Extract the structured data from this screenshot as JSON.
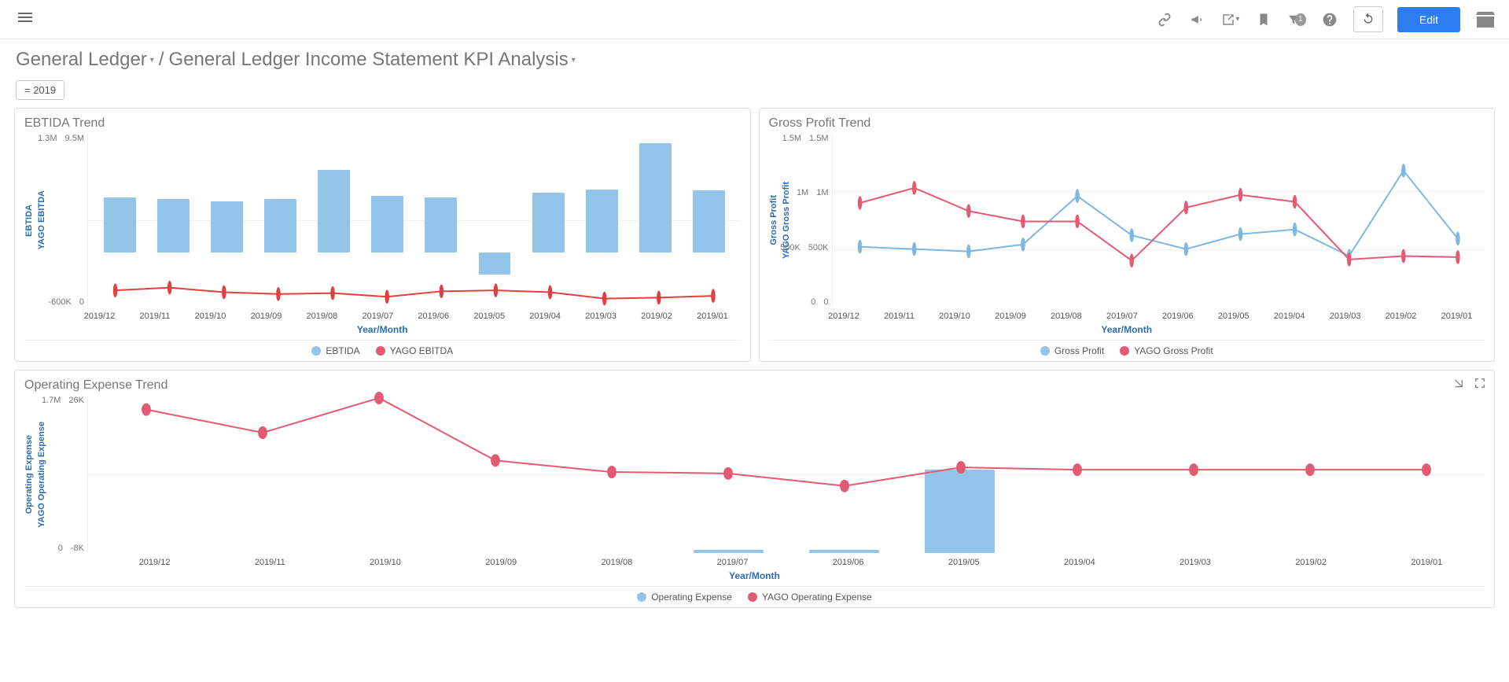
{
  "toolbar": {
    "filter_badge": "1",
    "edit_label": "Edit"
  },
  "breadcrumb": {
    "root": "General Ledger",
    "separator": "/",
    "page": "General Ledger Income Statement KPI Analysis"
  },
  "filter_chip": "= 2019",
  "panels": {
    "ebtida": {
      "title": "EBTIDA Trend",
      "y_left_top": "1.3M",
      "y_left_bot": "-600K",
      "y_right_top": "9.5M",
      "y_right_bot": "0",
      "axis1": "EBTIDA",
      "axis2": "YAGO EBITDA",
      "xlabel": "Year/Month",
      "legend1": "EBTIDA",
      "legend2": "YAGO EBITDA"
    },
    "gross": {
      "title": "Gross Profit Trend",
      "y_left_top": "1.5M",
      "y_left_mid": "1M",
      "y_left_low": "500K",
      "y_left_bot": "0",
      "y_right_top": "1.5M",
      "y_right_mid": "1M",
      "y_right_low": "500K",
      "y_right_bot": "0",
      "axis1": "Gross Profit",
      "axis2": "YAGO Gross Profit",
      "xlabel": "Year/Month",
      "legend1": "Gross Profit",
      "legend2": "YAGO Gross Profit"
    },
    "opex": {
      "title": "Operating Expense Trend",
      "y_left_top": "1.7M",
      "y_left_bot": "0",
      "y_right_top": "26K",
      "y_right_bot": "-8K",
      "axis1": "Operating Expense",
      "axis2": "YAGO Operating Expense",
      "xlabel": "Year/Month",
      "legend1": "Operating Expense",
      "legend2": "YAGO Operating Expense"
    }
  },
  "categories": [
    "2019/12",
    "2019/11",
    "2019/10",
    "2019/09",
    "2019/08",
    "2019/07",
    "2019/06",
    "2019/05",
    "2019/04",
    "2019/03",
    "2019/02",
    "2019/01"
  ],
  "chart_data": [
    {
      "id": "ebtida",
      "type": "bar+line",
      "title": "EBTIDA Trend",
      "categories": [
        "2019/12",
        "2019/11",
        "2019/10",
        "2019/09",
        "2019/08",
        "2019/07",
        "2019/06",
        "2019/05",
        "2019/04",
        "2019/03",
        "2019/02",
        "2019/01"
      ],
      "series": [
        {
          "name": "EBTIDA",
          "type": "bar",
          "axis": "left",
          "values": [
            600000,
            580000,
            560000,
            580000,
            900000,
            620000,
            600000,
            -250000,
            650000,
            690000,
            1200000,
            680000
          ]
        },
        {
          "name": "YAGO EBITDA",
          "type": "line",
          "axis": "right",
          "values": [
            900000,
            1050000,
            800000,
            700000,
            750000,
            550000,
            850000,
            900000,
            800000,
            450000,
            500000,
            600000
          ]
        }
      ],
      "xlabel": "Year/Month",
      "ylabel_left": "EBTIDA",
      "ylabel_right": "YAGO EBITDA",
      "ylim_left": [
        -600000,
        1300000
      ],
      "ylim_right": [
        0,
        9500000
      ]
    },
    {
      "id": "gross",
      "type": "line",
      "title": "Gross Profit Trend",
      "categories": [
        "2019/12",
        "2019/11",
        "2019/10",
        "2019/09",
        "2019/08",
        "2019/07",
        "2019/06",
        "2019/05",
        "2019/04",
        "2019/03",
        "2019/02",
        "2019/01"
      ],
      "series": [
        {
          "name": "Gross Profit",
          "type": "line",
          "axis": "left",
          "values": [
            520000,
            500000,
            480000,
            540000,
            960000,
            620000,
            500000,
            630000,
            670000,
            440000,
            1180000,
            590000
          ]
        },
        {
          "name": "YAGO Gross Profit",
          "type": "line",
          "axis": "right",
          "values": [
            900000,
            1030000,
            830000,
            740000,
            740000,
            400000,
            860000,
            970000,
            910000,
            410000,
            440000,
            430000
          ]
        }
      ],
      "xlabel": "Year/Month",
      "ylabel_left": "Gross Profit",
      "ylabel_right": "YAGO Gross Profit",
      "ylim_left": [
        0,
        1500000
      ],
      "ylim_right": [
        0,
        1500000
      ]
    },
    {
      "id": "opex",
      "type": "bar+line",
      "title": "Operating Expense Trend",
      "categories": [
        "2019/12",
        "2019/11",
        "2019/10",
        "2019/09",
        "2019/08",
        "2019/07",
        "2019/06",
        "2019/05",
        "2019/04",
        "2019/03",
        "2019/02",
        "2019/01"
      ],
      "series": [
        {
          "name": "Operating Expense",
          "type": "bar",
          "axis": "left",
          "values": [
            0,
            0,
            0,
            0,
            0,
            30000,
            30000,
            900000,
            0,
            0,
            0,
            0
          ]
        },
        {
          "name": "YAGO Operating Expense",
          "type": "line",
          "axis": "right",
          "values": [
            23000,
            18000,
            25500,
            12000,
            9500,
            9200,
            6500,
            10500,
            10000,
            10000,
            10000,
            10000
          ]
        }
      ],
      "xlabel": "Year/Month",
      "ylabel_left": "Operating Expense",
      "ylabel_right": "YAGO Operating Expense",
      "ylim_left": [
        0,
        1700000
      ],
      "ylim_right": [
        -8000,
        26000
      ]
    }
  ]
}
